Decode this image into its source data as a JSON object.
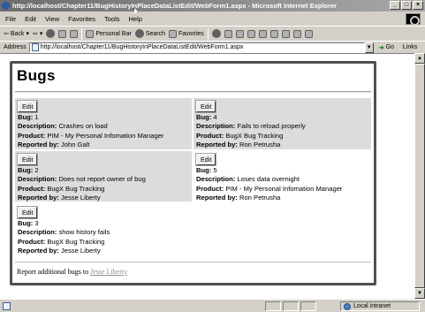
{
  "window": {
    "title": "http://localhost/Chapter11/BugHistoryInPlaceDataListEdit/WebForm1.aspx - Microsoft Internet Explorer"
  },
  "menu": [
    "File",
    "Edit",
    "View",
    "Favorites",
    "Tools",
    "Help"
  ],
  "toolbar": {
    "back": "Back",
    "personal_bar": "Personal Bar",
    "search": "Search",
    "favorites": "Favorites"
  },
  "address": {
    "label": "Address",
    "url": "http://localhost/Chapter11/BugHistoryInPlaceDataListEdit/WebForm1.aspx",
    "go": "Go",
    "links": "Links"
  },
  "page": {
    "title": "Bugs",
    "edit_label": "Edit",
    "labels": {
      "bug": "Bug:",
      "description": "Description:",
      "product": "Product:",
      "reported_by": "Reported by:"
    },
    "bugs": [
      {
        "id": "1",
        "description": "Crashes on load",
        "product": "PIM - My Personal Infomation Manager",
        "reporter": "John Galt"
      },
      {
        "id": "2",
        "description": "Does not report owner of bug",
        "product": "BugX Bug Tracking",
        "reporter": "Jesse Liberty"
      },
      {
        "id": "3",
        "description": "show history fails",
        "product": "BugX Bug Tracking",
        "reporter": "Jesse Liberty"
      },
      {
        "id": "4",
        "description": "Fails to reload properly",
        "product": "BugX Bug Tracking",
        "reporter": "Ron Petrusha"
      },
      {
        "id": "5",
        "description": "Loses data overnight",
        "product": "PIM - My Personal Infomation Manager",
        "reporter": "Ron Petrusha"
      }
    ],
    "footer_text": "Report additional bugs to",
    "footer_link": "Jesse Liberty"
  },
  "status": {
    "zone": "Local intranet"
  }
}
